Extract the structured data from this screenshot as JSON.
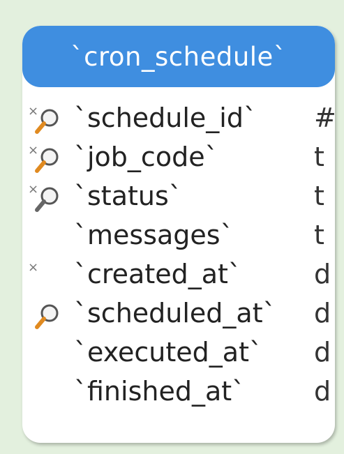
{
  "table": {
    "title": "`cron_schedule`",
    "header_color": "#3f8ee0",
    "fields": [
      {
        "name": "`schedule_id`",
        "type": "#",
        "marker": "×",
        "indexed": true,
        "index_icon": "orange-magnifier-icon"
      },
      {
        "name": "`job_code`",
        "type": "t",
        "marker": "×",
        "indexed": true,
        "index_icon": "orange-magnifier-icon"
      },
      {
        "name": "`status`",
        "type": "t",
        "marker": "×",
        "indexed": true,
        "index_icon": "gray-magnifier-icon"
      },
      {
        "name": "`messages`",
        "type": "t",
        "marker": "",
        "indexed": false
      },
      {
        "name": "`created_at`",
        "type": "d",
        "marker": "×",
        "indexed": false
      },
      {
        "name": "`scheduled_at`",
        "type": "d",
        "marker": "",
        "indexed": true,
        "index_icon": "orange-magnifier-icon"
      },
      {
        "name": "`executed_at`",
        "type": "d",
        "marker": "",
        "indexed": false
      },
      {
        "name": "`finished_at`",
        "type": "d",
        "marker": "",
        "indexed": false
      }
    ]
  }
}
